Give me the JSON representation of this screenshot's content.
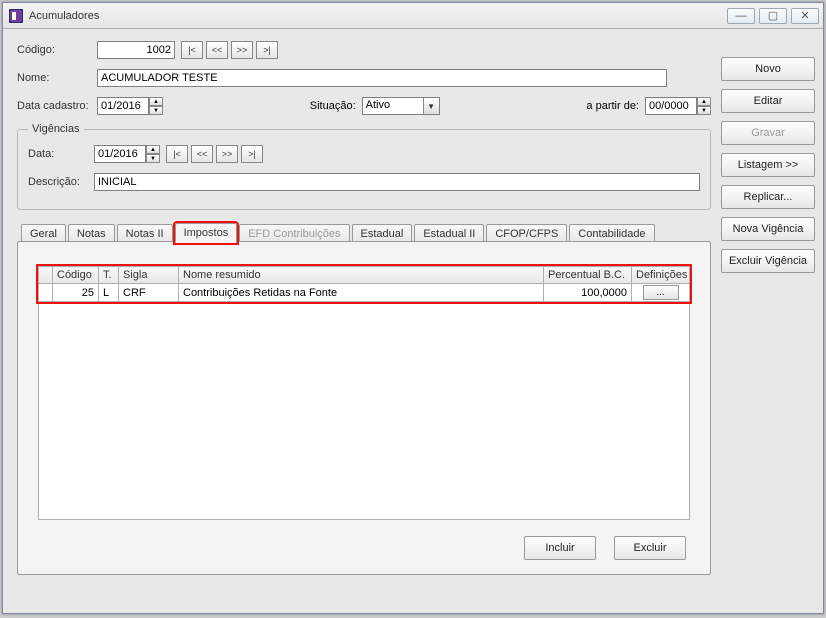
{
  "window": {
    "title": "Acumuladores",
    "min": "—",
    "max": "▢",
    "close": "✕"
  },
  "side": {
    "novo": "Novo",
    "editar": "Editar",
    "gravar": "Gravar",
    "listagem": "Listagem >>",
    "replicar": "Replicar...",
    "nova_vig": "Nova Vigência",
    "excl_vig": "Excluir Vigência"
  },
  "main": {
    "codigo_label": "Código:",
    "codigo_value": "1002",
    "nome_label": "Nome:",
    "nome_value": "ACUMULADOR TESTE",
    "datacad_label": "Data cadastro:",
    "datacad_value": "01/2016",
    "situacao_label": "Situação:",
    "situacao_value": "Ativo",
    "apartir_label": "a partir de:",
    "apartir_value": "00/0000",
    "nav": {
      "first": "|<",
      "prev": "<<",
      "next": ">>",
      "last": ">|"
    }
  },
  "vig": {
    "legend": "Vigências",
    "data_label": "Data:",
    "data_value": "01/2016",
    "descr_label": "Descrição:",
    "descr_value": "INICIAL"
  },
  "tabs": {
    "geral": "Geral",
    "notas": "Notas",
    "notas2": "Notas II",
    "impostos": "Impostos",
    "efd": "EFD Contribuições",
    "estadual": "Estadual",
    "estadual2": "Estadual II",
    "cfop": "CFOP/CFPS",
    "contab": "Contabilidade"
  },
  "grid": {
    "col_codigo": "Código",
    "col_t": "T.",
    "col_sigla": "Sigla",
    "col_nome": "Nome resumido",
    "col_pct": "Percentual B.C.",
    "col_def": "Definições",
    "row": {
      "codigo": "25",
      "t": "L",
      "sigla": "CRF",
      "nome": "Contribuições Retidas na Fonte",
      "pct": "100,0000",
      "def": "..."
    }
  },
  "btns": {
    "incluir": "Incluir",
    "excluir": "Excluir"
  }
}
